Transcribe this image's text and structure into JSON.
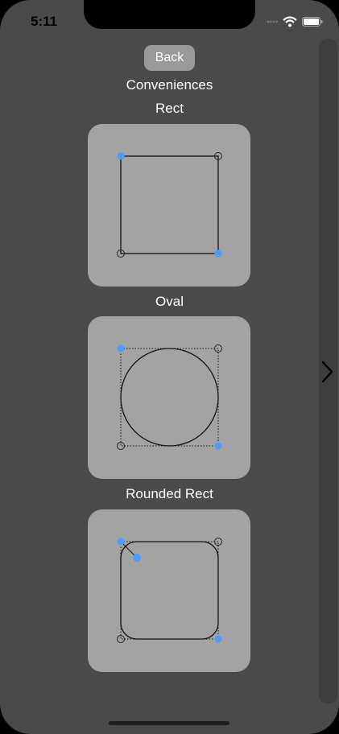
{
  "status_bar": {
    "time": "5:11",
    "icons": [
      "cellular-dots-icon",
      "wifi-icon",
      "battery-icon"
    ]
  },
  "header": {
    "back_label": "Back",
    "title": "Conveniences"
  },
  "sections": [
    {
      "label": "Rect",
      "shape": "rect"
    },
    {
      "label": "Oval",
      "shape": "oval"
    },
    {
      "label": "Rounded Rect",
      "shape": "rounded-rect"
    }
  ],
  "side_panel": {
    "icon": "chevron-right-icon"
  },
  "colors": {
    "background": "#4a4a4a",
    "panel": "#a3a3a3",
    "handle_active": "#4c9bff",
    "button": "#999999"
  }
}
